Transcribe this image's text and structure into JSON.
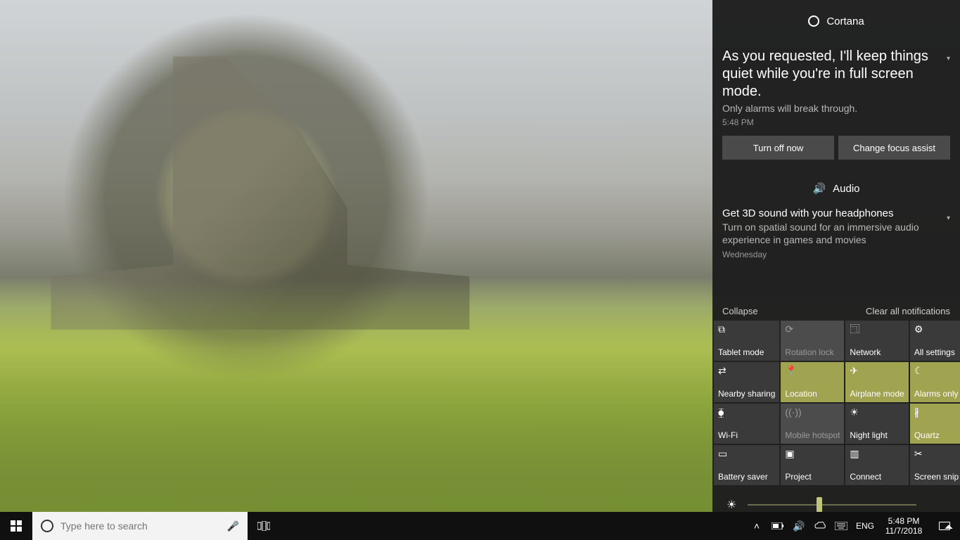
{
  "search": {
    "placeholder": "Type here to search"
  },
  "systray": {
    "lang": "ENG",
    "time": "5:48 PM",
    "date": "11/7/2018"
  },
  "actionCenter": {
    "brightness": 42,
    "controls": {
      "collapse": "Collapse",
      "clear": "Clear all notifications"
    },
    "groups": [
      {
        "app": "Cortana",
        "icon": "cortana",
        "title": "As you requested, I'll keep things quiet while you're in full screen mode.",
        "body": "Only alarms will break through.",
        "time": "5:48 PM",
        "buttons": [
          "Turn off now",
          "Change focus assist"
        ]
      },
      {
        "app": "Audio",
        "icon": "audio",
        "title": "Get 3D sound with your headphones",
        "body": "Turn on spatial sound for an immersive audio experience in games and movies",
        "time": "Wednesday"
      }
    ],
    "tiles": [
      {
        "label": "Tablet mode",
        "state": "normal",
        "icon": "tablet"
      },
      {
        "label": "Rotation lock",
        "state": "disabled",
        "icon": "rotation"
      },
      {
        "label": "Network",
        "state": "normal",
        "icon": "network"
      },
      {
        "label": "All settings",
        "state": "normal",
        "icon": "settings"
      },
      {
        "label": "Nearby sharing",
        "state": "normal",
        "icon": "share"
      },
      {
        "label": "Location",
        "state": "active",
        "icon": "location"
      },
      {
        "label": "Airplane mode",
        "state": "active",
        "icon": "airplane"
      },
      {
        "label": "Alarms only",
        "state": "active",
        "icon": "moon"
      },
      {
        "label": "Wi-Fi",
        "state": "normal",
        "icon": "wifi"
      },
      {
        "label": "Mobile hotspot",
        "state": "disabled",
        "icon": "hotspot"
      },
      {
        "label": "Night light",
        "state": "normal",
        "icon": "sun"
      },
      {
        "label": "Quartz",
        "state": "active",
        "icon": "bluetooth"
      },
      {
        "label": "Battery saver",
        "state": "normal",
        "icon": "battery"
      },
      {
        "label": "Project",
        "state": "normal",
        "icon": "project"
      },
      {
        "label": "Connect",
        "state": "normal",
        "icon": "connect"
      },
      {
        "label": "Screen snip",
        "state": "normal",
        "icon": "snip"
      }
    ]
  },
  "iconGlyphs": {
    "tablet": "⧉",
    "rotation": "⟳",
    "network": "⿹",
    "settings": "⚙",
    "share": "⇄",
    "location": "📍",
    "airplane": "✈",
    "moon": "☾",
    "wifi": "⧳",
    "hotspot": "((·))",
    "sun": "☀",
    "bluetooth": "∦",
    "battery": "▭",
    "project": "▣",
    "connect": "▥",
    "snip": "✂",
    "cortana": "◯",
    "audio": "🔊"
  }
}
